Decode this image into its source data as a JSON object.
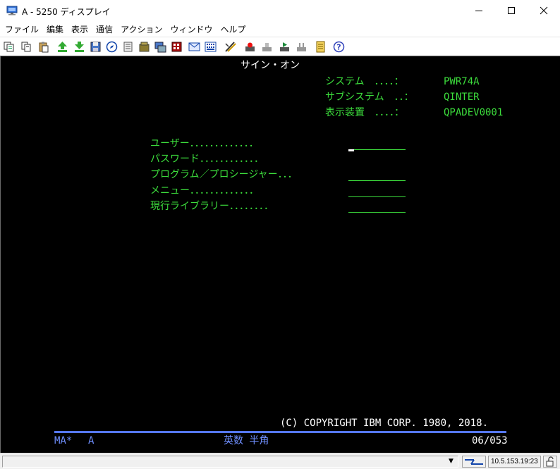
{
  "window": {
    "title": "A - 5250 ディスプレイ"
  },
  "menu": {
    "items": [
      "ファイル",
      "編集",
      "表示",
      "通信",
      "アクション",
      "ウィンドウ",
      "ヘルプ"
    ]
  },
  "toolbar": {
    "icons": [
      "copy-icon",
      "copy-append-icon",
      "paste-icon",
      "send-icon",
      "receive-icon",
      "save-icon",
      "navigator-icon",
      "note-icon",
      "package-icon",
      "transfer-icon",
      "macro-icon",
      "mail-icon",
      "keypad-icon",
      "edit-icon",
      "play-icon",
      "stop-icon",
      "record-icon",
      "pause-icon",
      "notes-icon",
      "help-icon"
    ]
  },
  "screen": {
    "title": "サイン・オン",
    "system_label": "システム　．．．．：",
    "system_value": "PWR74A",
    "subsystem_label": "サブシステム　．．：",
    "subsystem_value": "QINTER",
    "device_label": "表示装置　．．．．：",
    "device_value": "QPADEV0001",
    "user_label": "ユーザー．．．．．．．．．．．．．",
    "password_label": "パスワード．．．．．．．．．．．．",
    "program_label": "プログラム／プロシージャー．．．",
    "menu_label": "メニュー．．．．．．．．．．．．．",
    "library_label": "現行ライブラリー．．．．．．．．",
    "copyright": "(C) COPYRIGHT IBM CORP. 1980, 2018."
  },
  "oia": {
    "session": "MA*",
    "session_id": "A",
    "input_mode": "英数 半角",
    "cursor_position": "06/053"
  },
  "statusbar": {
    "ip_address": "10.5.153.19:23"
  },
  "colors": {
    "terminal_background": "#000000",
    "terminal_text": "#3cdc3c",
    "terminal_title": "#ffffff",
    "oia_accent": "#5577ff"
  }
}
